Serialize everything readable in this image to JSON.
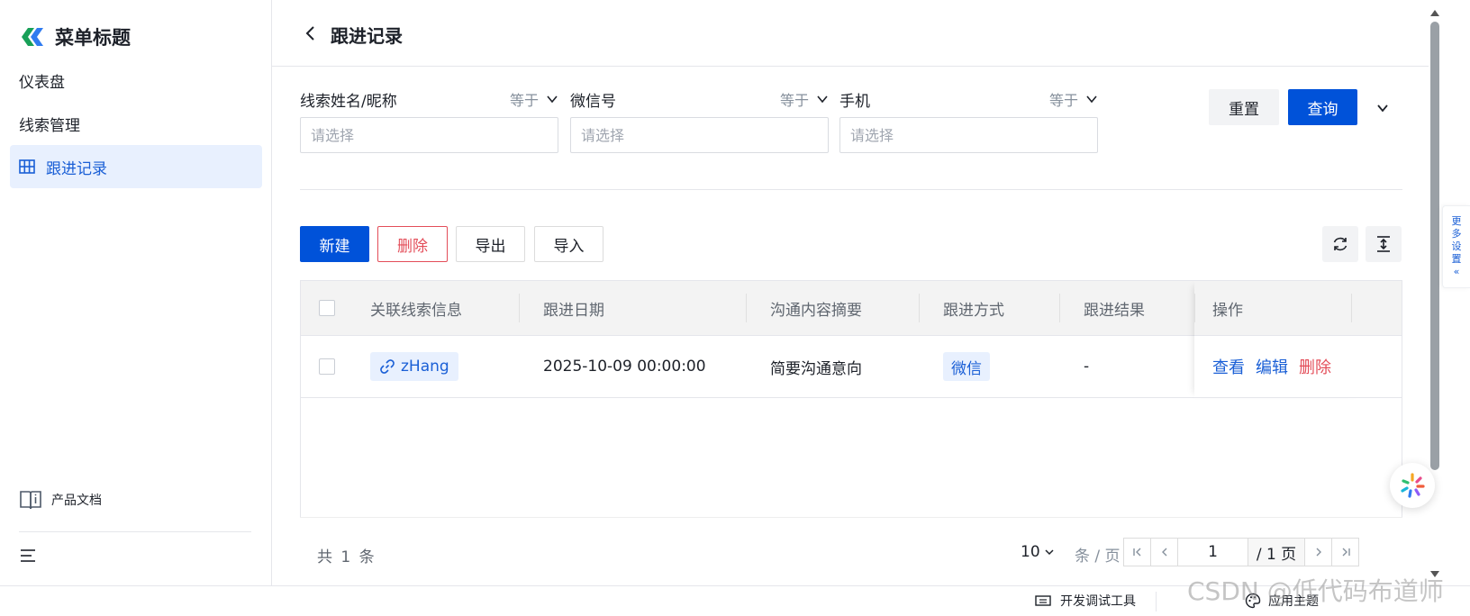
{
  "sidebar": {
    "brand_title": "菜单标题",
    "items": [
      {
        "label": "仪表盘"
      },
      {
        "label": "线索管理"
      },
      {
        "label": "跟进记录"
      }
    ],
    "doc_label": "产品文档"
  },
  "header": {
    "title": "跟进记录"
  },
  "filters": [
    {
      "label": "线索姓名/昵称",
      "operator": "等于",
      "placeholder": "请选择"
    },
    {
      "label": "微信号",
      "operator": "等于",
      "placeholder": "请选择"
    },
    {
      "label": "手机",
      "operator": "等于",
      "placeholder": "请选择"
    }
  ],
  "actions": {
    "reset": "重置",
    "query": "查询"
  },
  "toolbar": {
    "new": "新建",
    "delete": "删除",
    "export": "导出",
    "import": "导入"
  },
  "table": {
    "columns": [
      "关联线索信息",
      "跟进日期",
      "沟通内容摘要",
      "跟进方式",
      "跟进结果",
      "操作"
    ],
    "rows": [
      {
        "lead": "zHang",
        "date": "2025-10-09 00:00:00",
        "summary": "简要沟通意向",
        "method": "微信",
        "result": "-",
        "ops": {
          "view": "查看",
          "edit": "编辑",
          "delete": "删除"
        }
      }
    ]
  },
  "pagination": {
    "total_text": "共 1 条",
    "page_size": "10",
    "page_size_unit": "条 / 页",
    "current_page": "1",
    "total_pages_text": "/ 1 页"
  },
  "side_panel": {
    "more_settings": [
      "更",
      "多",
      "设",
      "置",
      "«"
    ]
  },
  "bottom_bar": {
    "devtools": "开发调试工具",
    "theme": "应用主题"
  },
  "watermark": "CSDN @低代码布道师",
  "colors": {
    "primary": "#0052d9",
    "danger": "#e34d59",
    "link": "#1a5fd6"
  }
}
